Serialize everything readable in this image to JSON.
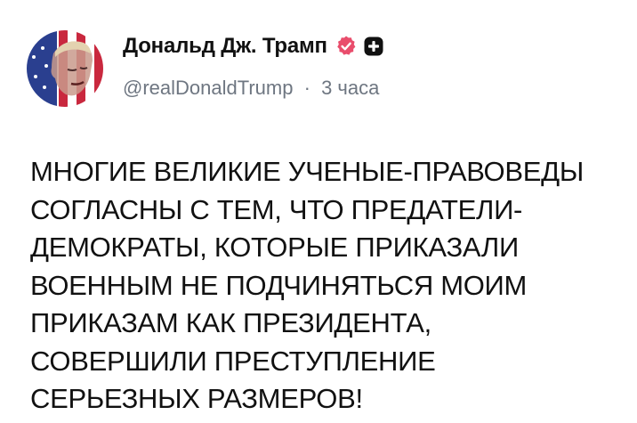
{
  "author": {
    "display_name": "Дональд Дж. Трамп",
    "handle": "@realDonaldTrump",
    "separator": "·",
    "time_ago": "3 часа",
    "avatar_icon": "avatar-flag-portrait",
    "verified_icon": "verified-badge-icon",
    "app_icon": "app-badge-icon",
    "colors": {
      "verified": "#e94d6c",
      "app_badge": "#111111",
      "handle": "#6e7681"
    }
  },
  "post": {
    "text": "МНОГИЕ ВЕЛИКИЕ УЧЕНЫЕ-ПРАВОВЕДЫ\nСОГЛАСНЫ С ТЕМ, ЧТО ПРЕДАТЕЛИ-\nДЕМОКРАТЫ, КОТОРЫЕ ПРИКАЗАЛИ\nВОЕННЫМ НЕ ПОДЧИНЯТЬСЯ МОИМ\nПРИКАЗАМ КАК ПРЕЗИДЕНТА,\nСОВЕРШИЛИ ПРЕСТУПЛЕНИЕ\nСЕРЬЕЗНЫХ РАЗМЕРОВ!"
  }
}
